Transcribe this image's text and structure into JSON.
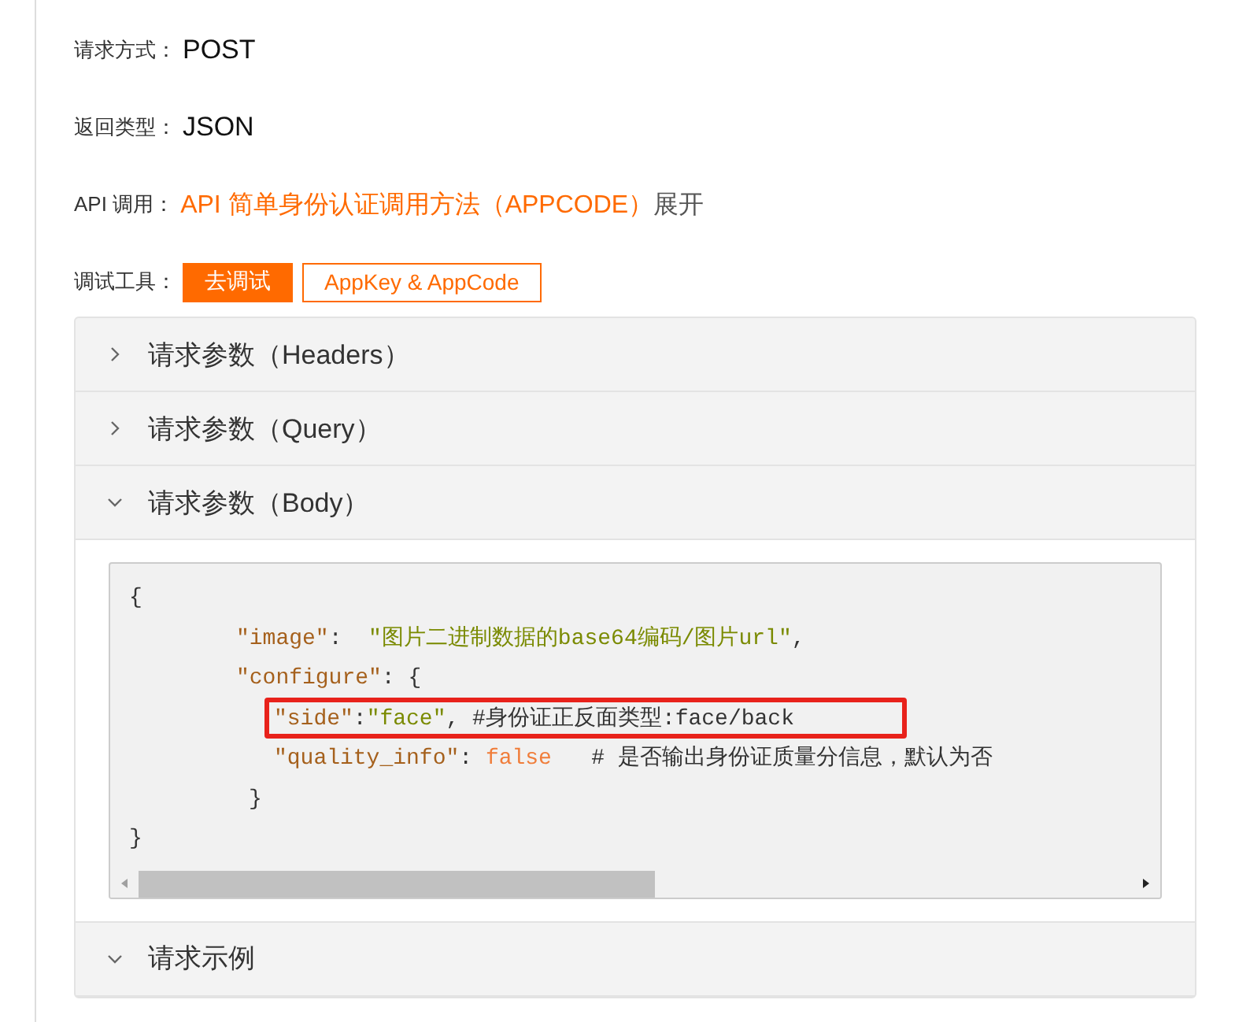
{
  "info_rows": [
    {
      "label": "请求方式：",
      "value": "POST"
    },
    {
      "label": "返回类型：",
      "value": "JSON"
    }
  ],
  "api_call": {
    "label": "API 调用：",
    "link": "API 简单身份认证调用方法（APPCODE）",
    "expand": "展开"
  },
  "debug_tools": {
    "label": "调试工具：",
    "buttons": [
      {
        "label": "去调试",
        "kind": "primary"
      },
      {
        "label": "AppKey & AppCode",
        "kind": "outline"
      }
    ]
  },
  "sections": [
    {
      "title": "请求参数（Headers）",
      "expanded": false
    },
    {
      "title": "请求参数（Query）",
      "expanded": false
    },
    {
      "title": "请求参数（Body）",
      "expanded": true,
      "code_lines": [
        {
          "highlighted": false,
          "tokens": [
            {
              "kind": "punct",
              "text": "{"
            }
          ]
        },
        {
          "highlighted": false,
          "kind": "member",
          "tokens": [
            {
              "kind": "key",
              "text": "\"image\""
            },
            {
              "kind": "punct",
              "text": ":  "
            },
            {
              "kind": "string",
              "text": "\"图片二进制数据的base64编码/图片url\""
            },
            {
              "kind": "punct",
              "text": ","
            }
          ]
        },
        {
          "highlighted": false,
          "kind": "member",
          "tokens": [
            {
              "kind": "key",
              "text": "\"configure\""
            },
            {
              "kind": "punct",
              "text": ": {"
            }
          ]
        },
        {
          "highlighted": true,
          "kind": "nested",
          "tokens": [
            {
              "kind": "key",
              "text": "\"side\""
            },
            {
              "kind": "punct",
              "text": ":"
            },
            {
              "kind": "string",
              "text": "\"face\""
            },
            {
              "kind": "punct",
              "text": ", #身份证正反面类型:face/back"
            }
          ]
        },
        {
          "highlighted": false,
          "kind": "nested",
          "tokens": [
            {
              "kind": "key",
              "text": "\"quality_info\""
            },
            {
              "kind": "punct",
              "text": ": "
            },
            {
              "kind": "bool",
              "text": "false"
            },
            {
              "kind": "punct",
              "text": "   # 是否输出身份证质量分信息，默认为否"
            }
          ]
        },
        {
          "highlighted": false,
          "kind": "close",
          "tokens": [
            {
              "kind": "punct",
              "text": "}"
            }
          ]
        },
        {
          "highlighted": false,
          "tokens": [
            {
              "kind": "punct",
              "text": "}"
            }
          ]
        }
      ]
    },
    {
      "title": "请求示例",
      "expanded": true
    }
  ]
}
